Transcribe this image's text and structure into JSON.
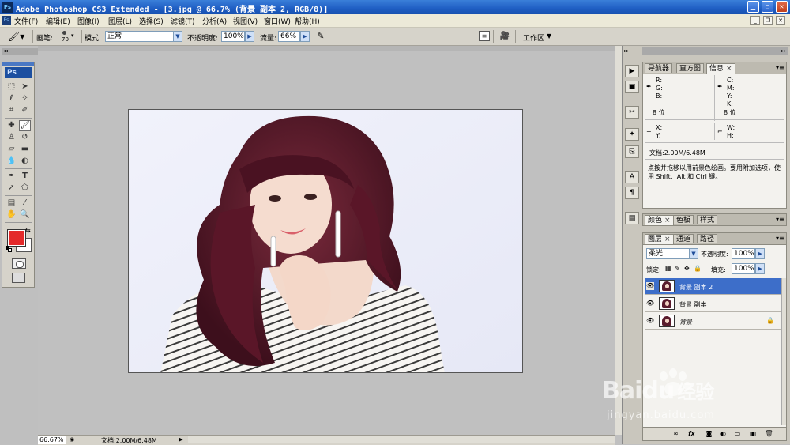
{
  "titlebar": {
    "app_icon": "Ps",
    "title": "Adobe Photoshop CS3 Extended - [3.jpg @ 66.7% (背景 副本 2, RGB/8)]",
    "minimize": "_",
    "restore": "❐",
    "close": "✕"
  },
  "menubar": {
    "items": [
      "文件(F)",
      "编辑(E)",
      "图像(I)",
      "图层(L)",
      "选择(S)",
      "滤镜(T)",
      "分析(A)",
      "视图(V)",
      "窗口(W)",
      "帮助(H)"
    ],
    "doc_minimize": "_",
    "doc_restore": "❐",
    "doc_close": "✕"
  },
  "options": {
    "brush_label": "画笔:",
    "brush_size": "70",
    "mode_label": "模式:",
    "mode_value": "正常",
    "opacity_label": "不透明度:",
    "opacity_value": "100%",
    "flow_label": "流量:",
    "flow_value": "66%",
    "workspace_label": "工作区"
  },
  "toolbox": {
    "badge": "Ps",
    "foreground_color": "#e42a2a",
    "background_color": "#ffffff"
  },
  "statusbar": {
    "zoom": "66.67%",
    "doc_info": "文档:2.00M/6.48M"
  },
  "info_panel": {
    "tabs": [
      "导航器",
      "直方图",
      "信息"
    ],
    "active_tab": "信息",
    "r": "R:",
    "g": "G:",
    "b": "B:",
    "c": "C:",
    "m": "M:",
    "y": "Y:",
    "k": "K:",
    "bits_left": "8 位",
    "bits_right": "8 位",
    "x": "X:",
    "y2": "Y:",
    "w": "W:",
    "h": "H:",
    "doc_info": "文档:2.00M/6.48M",
    "hint": "点按并拖移以用前景色绘画。要用附加选项，使用 Shift、Alt 和 Ctrl 键。"
  },
  "color_panel": {
    "tabs": [
      "颜色",
      "色板",
      "样式"
    ]
  },
  "layers_panel": {
    "tabs": [
      "图层",
      "通道",
      "路径"
    ],
    "blend_mode": "柔光",
    "opacity_label": "不透明度:",
    "opacity_value": "100%",
    "lock_label": "锁定:",
    "fill_label": "填充:",
    "fill_value": "100%",
    "layers": [
      {
        "name": "背景 副本 2",
        "selected": true
      },
      {
        "name": "背景 副本",
        "selected": false
      },
      {
        "name": "背景",
        "selected": false,
        "locked": true
      }
    ]
  },
  "watermark": {
    "brand": "Baidu",
    "brand_cn": "经验",
    "url": "jingyan.baidu.com"
  }
}
